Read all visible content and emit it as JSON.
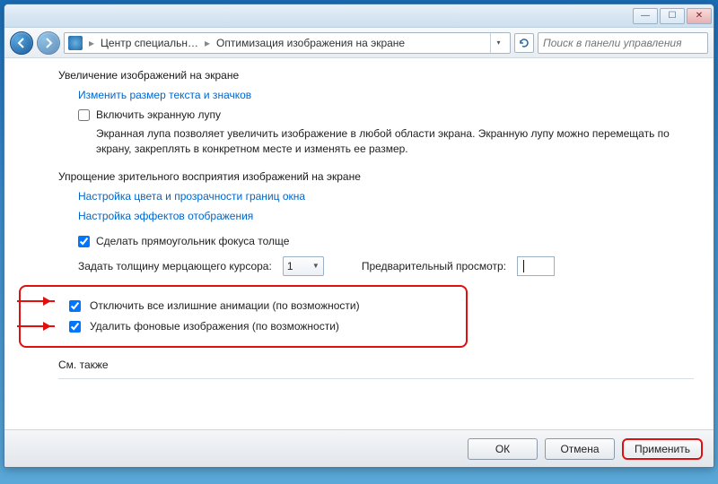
{
  "breadcrumb": {
    "part1": "Центр специальн…",
    "part2": "Оптимизация изображения на экране"
  },
  "search": {
    "placeholder": "Поиск в панели управления"
  },
  "section1": {
    "title": "Увеличение изображений на экране",
    "link": "Изменить размер текста и значков",
    "checkbox": "Включить экранную лупу",
    "help": "Экранная лупа позволяет увеличить изображение в любой области экрана. Экранную лупу можно перемещать по экрану, закреплять в конкретном месте и изменять ее размер."
  },
  "section2": {
    "title": "Упрощение зрительного восприятия изображений на экране",
    "link1": "Настройка цвета и прозрачности границ окна",
    "link2": "Настройка эффектов отображения",
    "checkbox_focus": "Сделать прямоугольник фокуса толще",
    "cursor_label": "Задать толщину мерцающего курсора:",
    "cursor_value": "1",
    "preview_label": "Предварительный просмотр:",
    "cb_anim": "Отключить все излишние анимации (по возможности)",
    "cb_bg": "Удалить фоновые изображения (по возможности)"
  },
  "seealso": "См. также",
  "buttons": {
    "ok": "ОК",
    "cancel": "Отмена",
    "apply": "Применить"
  }
}
